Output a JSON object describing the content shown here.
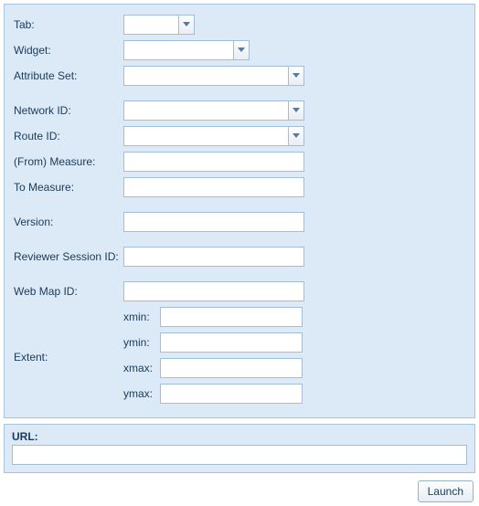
{
  "form": {
    "tab": {
      "label": "Tab:",
      "value": ""
    },
    "widget": {
      "label": "Widget:",
      "value": ""
    },
    "attribute_set": {
      "label": "Attribute Set:",
      "value": ""
    },
    "network_id": {
      "label": "Network ID:",
      "value": ""
    },
    "route_id": {
      "label": "Route ID:",
      "value": ""
    },
    "from_measure": {
      "label": "(From) Measure:",
      "value": ""
    },
    "to_measure": {
      "label": "To Measure:",
      "value": ""
    },
    "version": {
      "label": "Version:",
      "value": ""
    },
    "reviewer_session_id": {
      "label": "Reviewer Session ID:",
      "value": ""
    },
    "web_map_id": {
      "label": "Web Map ID:",
      "value": ""
    },
    "extent": {
      "label": "Extent:",
      "xmin": {
        "label": "xmin:",
        "value": ""
      },
      "ymin": {
        "label": "ymin:",
        "value": ""
      },
      "xmax": {
        "label": "xmax:",
        "value": ""
      },
      "ymax": {
        "label": "ymax:",
        "value": ""
      }
    }
  },
  "url": {
    "label": "URL:",
    "value": ""
  },
  "buttons": {
    "launch": "Launch"
  }
}
